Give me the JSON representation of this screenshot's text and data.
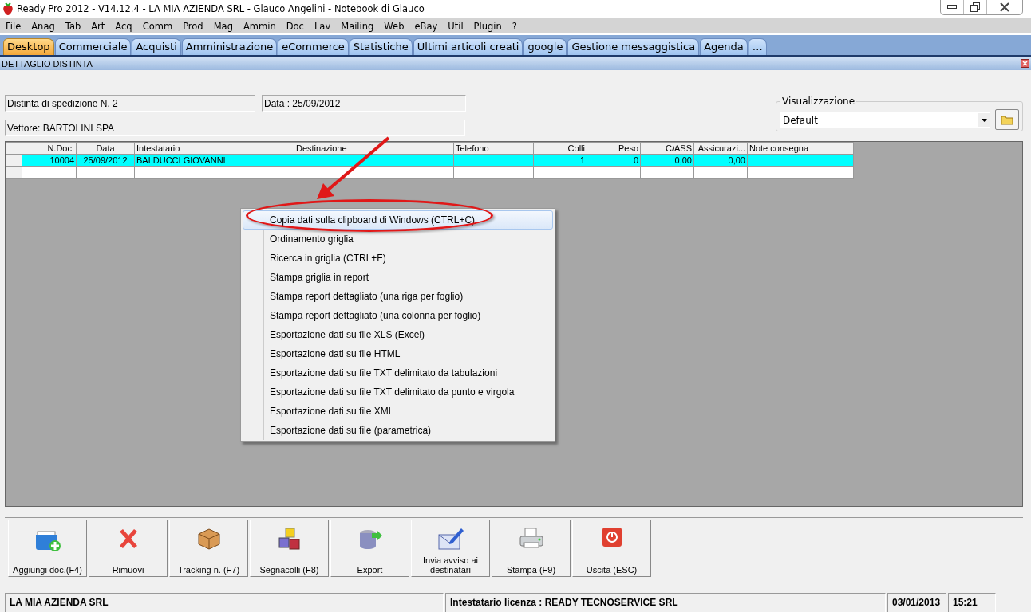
{
  "window": {
    "title": "Ready Pro 2012 - V14.12.4 - LA MIA AZIENDA SRL - Glauco Angelini - Notebook di Glauco"
  },
  "menu": [
    "File",
    "Anag",
    "Tab",
    "Art",
    "Acq",
    "Comm",
    "Prod",
    "Mag",
    "Ammin",
    "Doc",
    "Lav",
    "Mailing",
    "Web",
    "eBay",
    "Util",
    "Plugin",
    "?"
  ],
  "tabs": [
    {
      "label": "Desktop",
      "selected": true
    },
    {
      "label": "Commerciale",
      "selected": false
    },
    {
      "label": "Acquisti",
      "selected": false
    },
    {
      "label": "Amministrazione",
      "selected": false
    },
    {
      "label": "eCommerce",
      "selected": false
    },
    {
      "label": "Statistiche",
      "selected": false
    },
    {
      "label": "Ultimi articoli creati",
      "selected": false
    },
    {
      "label": "google",
      "selected": false
    },
    {
      "label": "Gestione messaggistica",
      "selected": false
    },
    {
      "label": "Agenda",
      "selected": false
    },
    {
      "label": "…",
      "selected": false
    }
  ],
  "panel": {
    "title": "DETTAGLIO DISTINTA"
  },
  "fields": {
    "distinta": "Distinta di spedizione N. 2",
    "data": "Data : 25/09/2012",
    "vettore": "Vettore: BARTOLINI SPA"
  },
  "visualizzazione": {
    "label": "Visualizzazione",
    "value": "Default"
  },
  "table": {
    "columns": [
      "N.Doc.",
      "Data",
      "Intestatario",
      "Destinazione",
      "Telefono",
      "Colli",
      "Peso",
      "C/ASS",
      "Assicurazi...",
      "Note consegna"
    ],
    "rows": [
      {
        "selected": true,
        "cells": [
          "10004",
          "25/09/2012",
          "BALDUCCI GIOVANNI",
          "",
          "",
          "1",
          "0",
          "0,00",
          "0,00",
          ""
        ]
      }
    ]
  },
  "context_menu": [
    {
      "label": "Copia dati sulla clipboard di Windows (CTRL+C)",
      "selected": true
    },
    {
      "label": "Ordinamento griglia",
      "selected": false
    },
    {
      "label": "Ricerca in griglia (CTRL+F)",
      "selected": false
    },
    {
      "label": "Stampa griglia in report",
      "selected": false
    },
    {
      "label": "Stampa report dettagliato (una riga per foglio)",
      "selected": false
    },
    {
      "label": "Stampa report dettagliato (una colonna per foglio)",
      "selected": false
    },
    {
      "label": "Esportazione dati su file XLS (Excel)",
      "selected": false
    },
    {
      "label": "Esportazione dati su file HTML",
      "selected": false
    },
    {
      "label": "Esportazione dati su file TXT delimitato da tabulazioni",
      "selected": false
    },
    {
      "label": "Esportazione dati su file TXT delimitato da punto e virgola",
      "selected": false
    },
    {
      "label": "Esportazione dati su file XML",
      "selected": false
    },
    {
      "label": "Esportazione dati su file (parametrica)",
      "selected": false
    }
  ],
  "toolbar": [
    {
      "label": "Aggiungi doc.(F4)",
      "kind": "add"
    },
    {
      "label": "Rimuovi",
      "kind": "remove"
    },
    {
      "label": "Tracking n. (F7)",
      "kind": "package"
    },
    {
      "label": "Segnacolli (F8)",
      "kind": "blocks"
    },
    {
      "label": "Export",
      "kind": "export"
    },
    {
      "label": "Invia avviso ai destinatari",
      "kind": "mail"
    },
    {
      "label": "Stampa (F9)",
      "kind": "printer"
    },
    {
      "label": "Uscita (ESC)",
      "kind": "exit"
    }
  ],
  "status_bar": [
    "LA MIA AZIENDA SRL",
    "Intestatario licenza : READY TECNOSERVICE SRL",
    "03/01/2013",
    "15:21"
  ]
}
